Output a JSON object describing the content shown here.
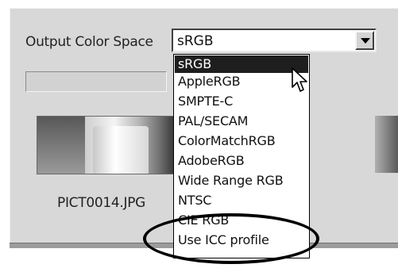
{
  "output_color_space": {
    "label": "Output Color Space",
    "selected_value": "sRGB",
    "options": [
      "sRGB",
      "AppleRGB",
      "SMPTE-C",
      "PAL/SECAM",
      "ColorMatchRGB",
      "AdobeRGB",
      "Wide Range RGB",
      "NTSC",
      "CIE RGB",
      "Use ICC profile"
    ],
    "highlighted_option": "sRGB",
    "circled_option": "Use ICC profile"
  },
  "preview": {
    "filename": "PICT0014.JPG"
  },
  "icons": {
    "dropdown_arrow": "chevron-down-icon",
    "pointer": "mouse-pointer-icon"
  },
  "colors": {
    "highlight": "#1e1e1e",
    "panel": "#d8d8d8"
  }
}
